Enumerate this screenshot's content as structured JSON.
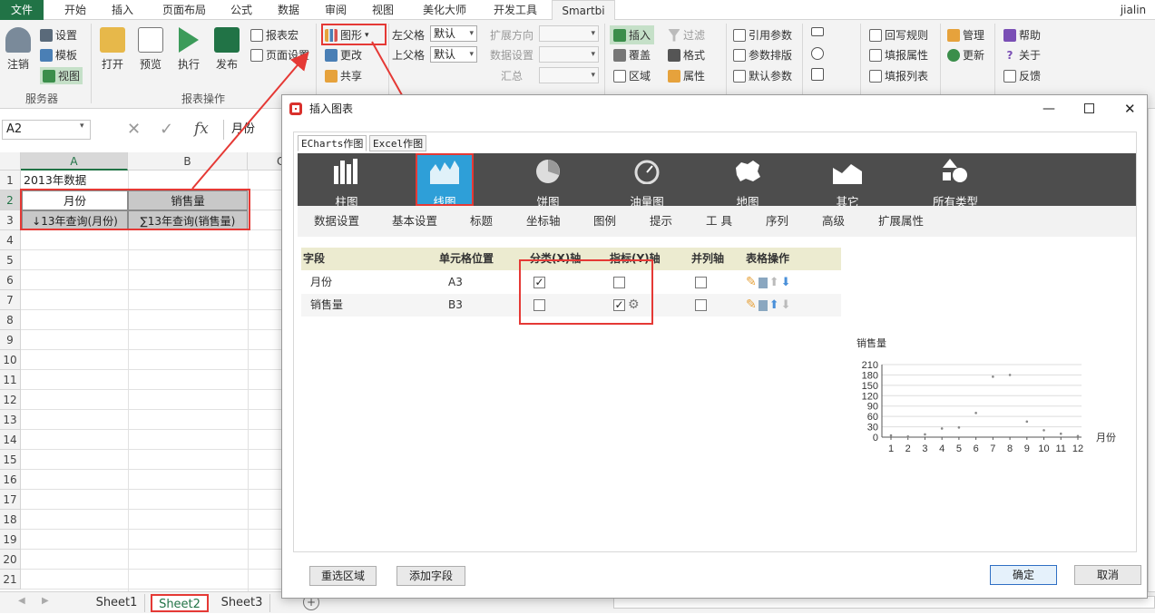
{
  "ribbon_tabs": [
    "文件",
    "开始",
    "插入",
    "页面布局",
    "公式",
    "数据",
    "审阅",
    "视图",
    "美化大师",
    "开发工具",
    "Smartbi"
  ],
  "user": "jialin",
  "ribbon": {
    "logout": "注销",
    "settings": "设置",
    "template": "模板",
    "view": "视图",
    "server_group": "服务器",
    "open": "打开",
    "preview": "预览",
    "execute": "执行",
    "publish": "发布",
    "report_macro": "报表宏",
    "page_settings": "页面设置",
    "report_ops_group": "报表操作",
    "chart": "图形",
    "change": "更改",
    "share": "共享",
    "left_parent": "左父格",
    "top_parent": "上父格",
    "default1": "默认",
    "default2": "默认",
    "expand_dir": "扩展方向",
    "data_settings": "数据设置",
    "summary": "汇总",
    "insert": "插入",
    "overlay": "覆盖",
    "region": "区域",
    "filter": "过滤",
    "format": "格式",
    "property": "属性",
    "ref_param": "引用参数",
    "param_layout": "参数排版",
    "default_param": "默认参数",
    "writeback_rule": "回写规则",
    "fill_property": "填报属性",
    "fill_list": "填报列表",
    "manage": "管理",
    "update": "更新",
    "help": "帮助",
    "about": "关于",
    "feedback": "反馈"
  },
  "formula": {
    "cell_ref": "A2",
    "value": "月份",
    "fx": "fx"
  },
  "sheet": {
    "columns": [
      "A",
      "B",
      "C"
    ],
    "rows": [
      "1",
      "2",
      "3",
      "4",
      "5",
      "6",
      "7",
      "8",
      "9",
      "10",
      "11",
      "12",
      "13",
      "14",
      "15",
      "16",
      "17",
      "18",
      "19",
      "20",
      "21"
    ],
    "a1": "2013年数据",
    "a2": "月份",
    "b2": "销售量",
    "a3": "↓13年查询(月份)",
    "b3": "∑13年查询(销售量)"
  },
  "sheet_tabs": [
    "Sheet1",
    "Sheet2",
    "Sheet3"
  ],
  "dialog": {
    "title": "插入图表",
    "subtabs": [
      "ECharts作图",
      "Excel作图"
    ],
    "chart_types": [
      "柱图",
      "线图",
      "饼图",
      "油量图",
      "地图",
      "其它",
      "所有类型"
    ],
    "config_tabs": [
      "数据设置",
      "基本设置",
      "标题",
      "坐标轴",
      "图例",
      "提示",
      "工 具",
      "序列",
      "高级",
      "扩展属性"
    ],
    "table_headers": [
      "字段",
      "单元格位置",
      "分类(X)轴",
      "指标(Y)轴",
      "并列轴",
      "表格操作"
    ],
    "rows": [
      {
        "field": "月份",
        "cell": "A3",
        "x_axis": true,
        "y_axis": false,
        "parallel": false
      },
      {
        "field": "销售量",
        "cell": "B3",
        "x_axis": false,
        "y_axis": true,
        "parallel": false
      }
    ],
    "buttons": {
      "reselect": "重选区域",
      "add_field": "添加字段",
      "ok": "确定",
      "cancel": "取消"
    }
  },
  "chart_data": {
    "type": "scatter",
    "title": "销售量",
    "xlabel": "月份",
    "ylabel": "",
    "x": [
      1,
      2,
      3,
      4,
      5,
      6,
      7,
      8,
      9,
      10,
      11,
      12
    ],
    "ylim": [
      0,
      210
    ],
    "yticks": [
      0,
      30,
      60,
      90,
      120,
      150,
      180,
      210
    ],
    "series": [
      {
        "values": [
          5,
          2,
          8,
          25,
          28,
          70,
          175,
          180,
          45,
          20,
          10,
          3
        ]
      }
    ]
  }
}
